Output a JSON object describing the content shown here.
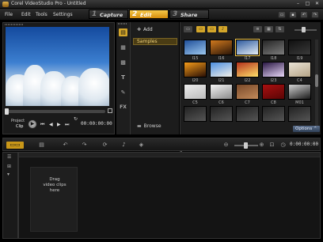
{
  "window": {
    "title": "Corel VideoStudio Pro - Untitled",
    "controls": [
      "–",
      "□",
      "✕"
    ]
  },
  "menu": [
    "File",
    "Edit",
    "Tools",
    "Settings"
  ],
  "steps": [
    {
      "num": "1",
      "label": "Capture",
      "active": false
    },
    {
      "num": "2",
      "label": "Edit",
      "active": true
    },
    {
      "num": "3",
      "label": "Share",
      "active": false
    }
  ],
  "player": {
    "mode_project": "Project",
    "mode_clip": "Clip",
    "controls": [
      "▶",
      "⏮",
      "◀",
      "▶",
      "⏭",
      "↻",
      "🔊"
    ],
    "timecode": "00:00:00:00"
  },
  "library": {
    "side_icons": [
      "media-icon",
      "instant-project-icon",
      "transition-icon",
      "title-icon",
      "graphic-icon",
      "filter-icon"
    ],
    "side_glyphs": [
      "▤",
      "▦",
      "▩",
      "T",
      "✎",
      "FX"
    ],
    "add_label": "Add",
    "folders": [
      "Samples"
    ],
    "browse_label": "Browse",
    "options_label": "Options"
  },
  "gallery": {
    "thumbnails": [
      {
        "label": "I15",
        "colors": [
          "#1f4f9a",
          "#9cc7ee"
        ]
      },
      {
        "label": "I16",
        "colors": [
          "#d27a1e",
          "#2a1508"
        ]
      },
      {
        "label": "I17",
        "colors": [
          "#2d5a9e",
          "#e6eef6"
        ]
      },
      {
        "label": "I18",
        "colors": [
          "#252525",
          "#7c7c7c"
        ]
      },
      {
        "label": "I19",
        "colors": [
          "#101010",
          "#3a3a3a"
        ]
      },
      {
        "label": "I20",
        "colors": [
          "#f59b1a",
          "#2a0f04"
        ]
      },
      {
        "label": "I21",
        "colors": [
          "#4c8fe0",
          "#f3f0e8"
        ]
      },
      {
        "label": "I22",
        "colors": [
          "#b4321c",
          "#ffdf6a"
        ]
      },
      {
        "label": "I23",
        "colors": [
          "#2a1744",
          "#e8d7f8"
        ]
      },
      {
        "label": "C4",
        "colors": [
          "#eae3d6",
          "#b5a486"
        ]
      },
      {
        "label": "C5",
        "colors": [
          "#ececec",
          "#bcbcbc"
        ]
      },
      {
        "label": "C6",
        "colors": [
          "#f4f4f4",
          "#8a8a8a"
        ]
      },
      {
        "label": "C7",
        "colors": [
          "#7a4a2a",
          "#c28a5a"
        ]
      },
      {
        "label": "C8",
        "colors": [
          "#aa1010",
          "#5a0505"
        ]
      },
      {
        "label": "M01",
        "colors": [
          "#d2d2d2",
          "#1a1a1a"
        ]
      },
      {
        "label": "",
        "colors": [
          "#222222",
          "#555555"
        ]
      },
      {
        "label": "",
        "colors": [
          "#222222",
          "#555555"
        ]
      },
      {
        "label": "",
        "colors": [
          "#222222",
          "#555555"
        ]
      },
      {
        "label": "",
        "colors": [
          "#222222",
          "#555555"
        ]
      },
      {
        "label": "",
        "colors": [
          "#222222",
          "#555555"
        ]
      }
    ],
    "selected_index": 2
  },
  "timeline": {
    "tools": [
      "▭▭",
      "▤",
      "↶",
      "↷",
      "⟳",
      "♪",
      "◈"
    ],
    "timecode": "0:00:00:00",
    "hint": "Drag\nvideo clips\nhere"
  },
  "colors": {
    "accent": "#e7a92a",
    "background": "#1b1b1b"
  }
}
